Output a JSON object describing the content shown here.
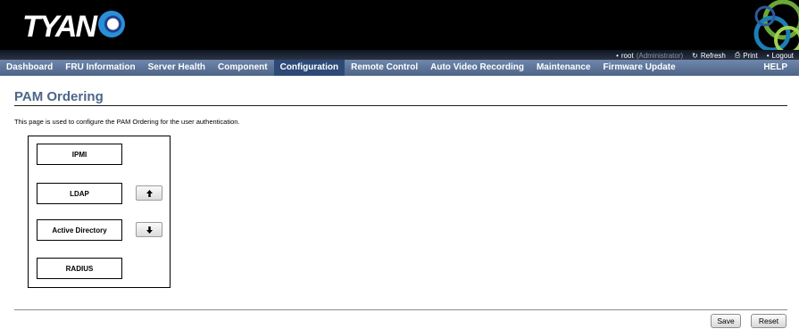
{
  "header": {
    "logo_text": "TYAN",
    "user": "root",
    "role": "(Administrator)",
    "refresh_label": "Refresh",
    "print_label": "Print",
    "logout_label": "Logout"
  },
  "nav": {
    "items": [
      {
        "label": "Dashboard"
      },
      {
        "label": "FRU Information"
      },
      {
        "label": "Server Health"
      },
      {
        "label": "Component"
      },
      {
        "label": "Configuration"
      },
      {
        "label": "Remote Control"
      },
      {
        "label": "Auto Video Recording"
      },
      {
        "label": "Maintenance"
      },
      {
        "label": "Firmware Update"
      }
    ],
    "active": "Configuration",
    "help_label": "HELP"
  },
  "page": {
    "title": "PAM Ordering",
    "description": "This page is used to configure the PAM Ordering for the user authentication."
  },
  "pam": {
    "items": [
      {
        "label": "IPMI"
      },
      {
        "label": "LDAP"
      },
      {
        "label": "Active Directory"
      },
      {
        "label": "RADIUS"
      }
    ]
  },
  "buttons": {
    "save_label": "Save",
    "reset_label": "Reset"
  },
  "colors": {
    "nav_bar": "#5a7399",
    "nav_active": "#2d4a77",
    "title": "#4b6789"
  }
}
